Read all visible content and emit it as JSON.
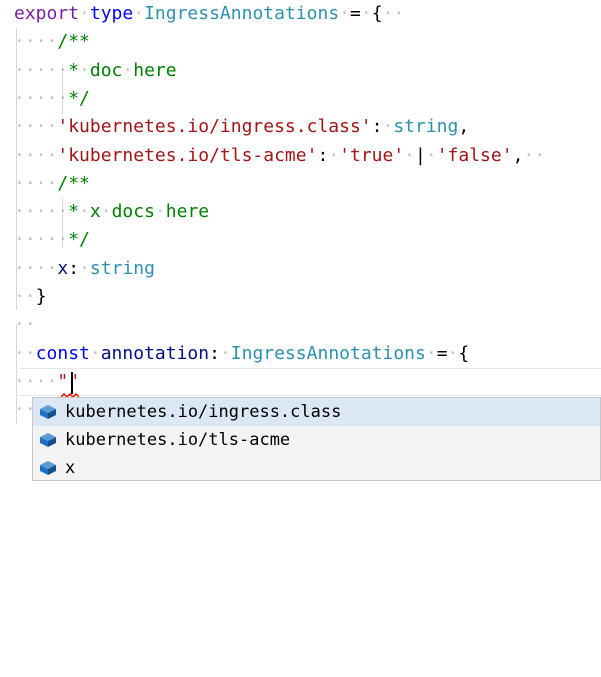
{
  "editor": {
    "lines": [
      {
        "indent": "",
        "tokens": [
          {
            "t": "export",
            "c": "#7b1fa2"
          },
          {
            "t": "·",
            "c": "#c3c3c3"
          },
          {
            "t": "type",
            "c": "#0000ff"
          },
          {
            "t": "·",
            "c": "#c3c3c3"
          },
          {
            "t": "IngressAnnotations",
            "c": "#2b91af"
          },
          {
            "t": "·",
            "c": "#c3c3c3"
          },
          {
            "t": "=",
            "c": "#000000"
          },
          {
            "t": "·",
            "c": "#c3c3c3"
          },
          {
            "t": "{",
            "c": "#000000"
          },
          {
            "t": "··",
            "c": "#c3c3c3"
          }
        ]
      },
      {
        "indent": "····",
        "tokens": [
          {
            "t": "/**",
            "c": "#008000"
          }
        ]
      },
      {
        "indent": "·····",
        "tokens": [
          {
            "t": "*",
            "c": "#008000"
          },
          {
            "t": "·",
            "c": "#c3c3c3"
          },
          {
            "t": "doc",
            "c": "#008000"
          },
          {
            "t": "·",
            "c": "#c3c3c3"
          },
          {
            "t": "here",
            "c": "#008000"
          }
        ]
      },
      {
        "indent": "·····",
        "tokens": [
          {
            "t": "*/",
            "c": "#008000"
          }
        ]
      },
      {
        "indent": "····",
        "tokens": [
          {
            "t": "'kubernetes.io/ingress.class'",
            "c": "#a31515"
          },
          {
            "t": ":",
            "c": "#000000"
          },
          {
            "t": "·",
            "c": "#c3c3c3"
          },
          {
            "t": "string",
            "c": "#2b91af"
          },
          {
            "t": ",",
            "c": "#000000"
          }
        ]
      },
      {
        "indent": "····",
        "tokens": [
          {
            "t": "'kubernetes.io/tls-acme'",
            "c": "#a31515"
          },
          {
            "t": ":",
            "c": "#000000"
          },
          {
            "t": "·",
            "c": "#c3c3c3"
          },
          {
            "t": "'true'",
            "c": "#a31515"
          },
          {
            "t": "·",
            "c": "#c3c3c3"
          },
          {
            "t": "|",
            "c": "#000000"
          },
          {
            "t": "·",
            "c": "#c3c3c3"
          },
          {
            "t": "'false'",
            "c": "#a31515"
          },
          {
            "t": ",",
            "c": "#000000"
          },
          {
            "t": "··",
            "c": "#c3c3c3"
          }
        ]
      },
      {
        "indent": "····",
        "tokens": [
          {
            "t": "/**",
            "c": "#008000"
          }
        ]
      },
      {
        "indent": "·····",
        "tokens": [
          {
            "t": "*",
            "c": "#008000"
          },
          {
            "t": "·",
            "c": "#c3c3c3"
          },
          {
            "t": "x",
            "c": "#008000"
          },
          {
            "t": "·",
            "c": "#c3c3c3"
          },
          {
            "t": "docs",
            "c": "#008000"
          },
          {
            "t": "·",
            "c": "#c3c3c3"
          },
          {
            "t": "here",
            "c": "#008000"
          }
        ]
      },
      {
        "indent": "·····",
        "tokens": [
          {
            "t": "*/",
            "c": "#008000"
          }
        ]
      },
      {
        "indent": "····",
        "tokens": [
          {
            "t": "x",
            "c": "#001080"
          },
          {
            "t": ":",
            "c": "#000000"
          },
          {
            "t": "·",
            "c": "#c3c3c3"
          },
          {
            "t": "string",
            "c": "#2b91af"
          }
        ]
      },
      {
        "indent": "··",
        "tokens": [
          {
            "t": "}",
            "c": "#000000"
          }
        ]
      },
      {
        "indent": "··",
        "tokens": []
      },
      {
        "indent": "··",
        "tokens": [
          {
            "t": "const",
            "c": "#0000ff"
          },
          {
            "t": "·",
            "c": "#c3c3c3"
          },
          {
            "t": "annotation",
            "c": "#001080"
          },
          {
            "t": ":",
            "c": "#000000"
          },
          {
            "t": "·",
            "c": "#c3c3c3"
          },
          {
            "t": "IngressAnnotations",
            "c": "#2b91af"
          },
          {
            "t": "·",
            "c": "#c3c3c3"
          },
          {
            "t": "=",
            "c": "#000000"
          },
          {
            "t": "·",
            "c": "#c3c3c3"
          },
          {
            "t": "{",
            "c": "#000000"
          }
        ]
      },
      {
        "indent": "····",
        "tokens": [
          {
            "t": "\"\"",
            "c": "#a31515"
          }
        ]
      },
      {
        "indent": "··",
        "tokens": []
      }
    ]
  },
  "suggest": {
    "items": [
      {
        "label": "kubernetes.io/ingress.class",
        "icon": "property-cube-icon",
        "selected": true
      },
      {
        "label": "kubernetes.io/tls-acme",
        "icon": "property-cube-icon",
        "selected": false
      },
      {
        "label": "x",
        "icon": "property-cube-icon",
        "selected": false
      }
    ]
  },
  "colors": {
    "icon": "#1f6fc5",
    "selection": "#dbe7f5",
    "error": "#e51400"
  }
}
